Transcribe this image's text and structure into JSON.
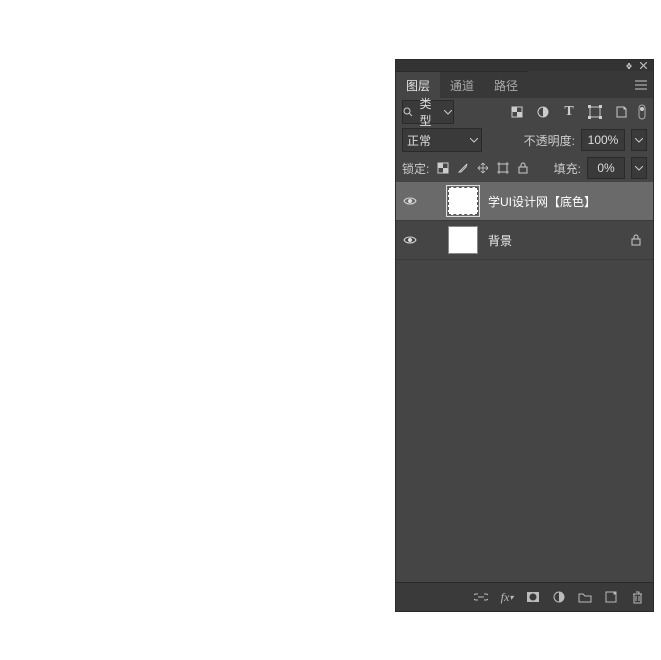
{
  "titlebar": {
    "collapse_icon": "collapse",
    "close_icon": "close"
  },
  "tabs": {
    "layers": "图层",
    "channels": "通道",
    "paths": "路径"
  },
  "filter": {
    "search_placeholder": "搜索",
    "kind_label": "类型"
  },
  "blend": {
    "mode": "正常",
    "opacity_label": "不透明度:",
    "opacity_value": "100%"
  },
  "lock": {
    "label": "锁定:",
    "fill_label": "填充:",
    "fill_value": "0%"
  },
  "layers": [
    {
      "name": "学UI设计网【底色】",
      "visible": true,
      "selected": true,
      "locked": false
    },
    {
      "name": "背景",
      "visible": true,
      "selected": false,
      "locked": true
    }
  ]
}
